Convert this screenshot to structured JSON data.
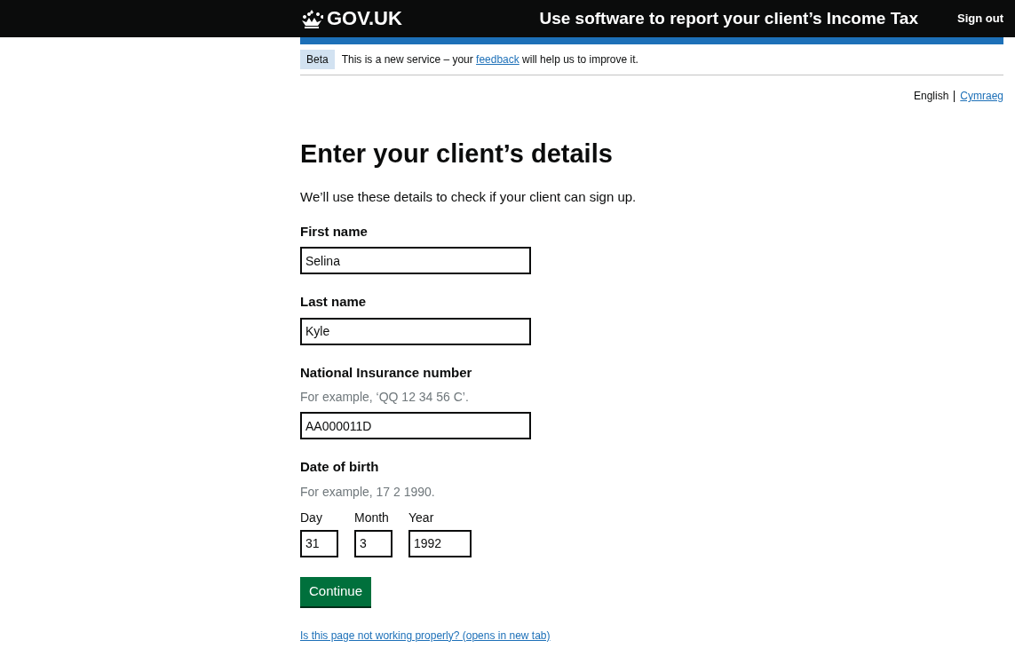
{
  "header": {
    "logo": "GOV.UK",
    "service": "Use software to report your client’s Income Tax",
    "sign_out": "Sign out"
  },
  "phase_banner": {
    "tag": "Beta",
    "text_before": "This is a new service – your",
    "link": "feedback",
    "text_after": "will help us to improve it."
  },
  "languages": [
    {
      "label": "English",
      "selected": true
    },
    {
      "label": "Cymraeg",
      "selected": false
    }
  ],
  "heading": "Enter your client’s details",
  "intro": "We’ll use these details to check if your client can sign up.",
  "fields": [
    {
      "label": "First name",
      "value": "Selina"
    },
    {
      "label": "Last name",
      "value": "Kyle"
    },
    {
      "label": "National Insurance number",
      "hint": "For example, ‘QQ 12 34 56 C’.",
      "value": "AA000011D"
    }
  ],
  "date_of_birth": {
    "label": "Date of birth",
    "hint": "For example, 17 2 1990.",
    "parts": [
      {
        "label": "Day",
        "value": "31",
        "kind": "short"
      },
      {
        "label": "Month",
        "value": "3",
        "kind": "short"
      },
      {
        "label": "Year",
        "value": "1992",
        "kind": "long"
      }
    ]
  },
  "continue_button": "Continue",
  "help_link": "Is this page not working properly? (opens in new tab)"
}
